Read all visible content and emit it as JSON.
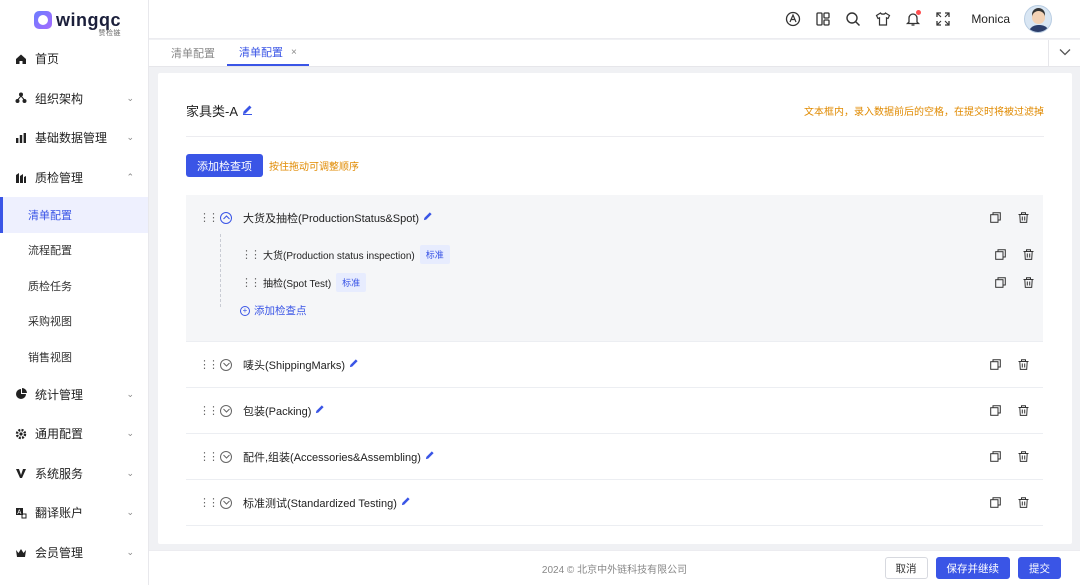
{
  "app": {
    "logo_text": "wingqc",
    "logo_sub": "赞检链"
  },
  "header": {
    "username": "Monica",
    "icons": [
      "translate-icon",
      "layout-icon",
      "search-icon",
      "shirt-icon",
      "bell-icon",
      "fullscreen-icon"
    ]
  },
  "sidebar": {
    "items": [
      {
        "label": "首页",
        "icon": "home-icon"
      },
      {
        "label": "组织架构",
        "icon": "org-icon",
        "expandable": true
      },
      {
        "label": "基础数据管理",
        "icon": "chart-icon",
        "expandable": true
      },
      {
        "label": "质检管理",
        "icon": "qc-icon",
        "expandable": true,
        "expanded": true
      }
    ],
    "sub_items": [
      {
        "label": "清单配置",
        "active": true
      },
      {
        "label": "流程配置"
      },
      {
        "label": "质检任务"
      },
      {
        "label": "采购视图"
      },
      {
        "label": "销售视图"
      }
    ],
    "items_after": [
      {
        "label": "统计管理",
        "icon": "pie-icon"
      },
      {
        "label": "通用配置",
        "icon": "settings-icon"
      },
      {
        "label": "系统服务",
        "icon": "service-icon"
      },
      {
        "label": "翻译账户",
        "icon": "translate-account-icon"
      },
      {
        "label": "会员管理",
        "icon": "crown-icon"
      }
    ]
  },
  "tabs": [
    {
      "label": "清单配置",
      "active": false
    },
    {
      "label": "清单配置",
      "active": true,
      "close": "×"
    }
  ],
  "main": {
    "title": "家具类-A",
    "hint": "文本框内，录入数据前后的空格，在提交时将被过滤掉",
    "add_button": "添加检查项",
    "drag_hint": "按住拖动可调整顺序",
    "groups": [
      {
        "label": "大货及抽检(ProductionStatus&Spot)",
        "expanded": true,
        "items": [
          {
            "label": "大货(Production status inspection)",
            "tag": "标准"
          },
          {
            "label": "抽检(Spot Test)",
            "tag": "标准"
          }
        ],
        "add_point": "添加检查点"
      },
      {
        "label": "唛头(ShippingMarks)"
      },
      {
        "label": "包装(Packing)"
      },
      {
        "label": "配件,组装(Accessories&Assembling)"
      },
      {
        "label": "标准测试(Standardized Testing)"
      }
    ]
  },
  "footer": {
    "copyright": "2024 © 北京中外链科技有限公司",
    "cancel": "取消",
    "save_continue": "保存并继续",
    "submit": "提交"
  },
  "colors": {
    "primary": "#3a55e6",
    "warning": "#e08a00"
  }
}
